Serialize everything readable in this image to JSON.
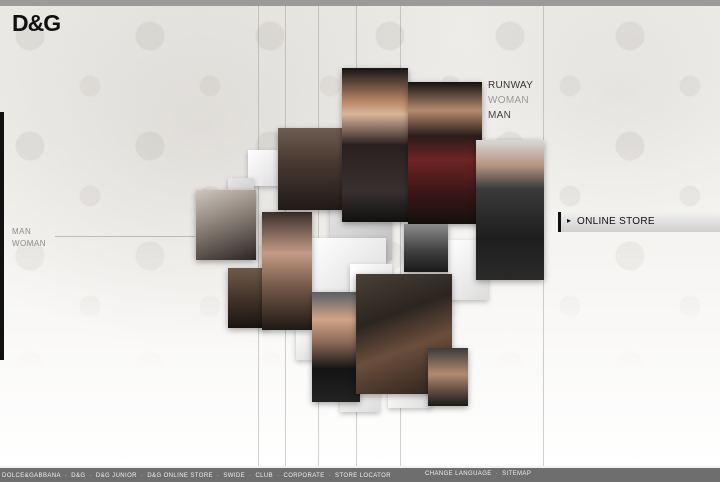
{
  "brand": {
    "logo_text": "D&G"
  },
  "side_nav": {
    "items": [
      "MAN",
      "WOMAN"
    ]
  },
  "collections_menu": {
    "items": [
      "RUNWAY",
      "WOMAN",
      "MAN"
    ]
  },
  "online_store": {
    "arrow": "▸",
    "label": "ONLINE STORE"
  },
  "footer": {
    "left_links": [
      "DOLCE&GABBANA",
      "D&G",
      "D&G JUNIOR",
      "D&G ONLINE STORE",
      "SWIDE",
      "CLUB",
      "CORPORATE",
      "STORE LOCATOR"
    ],
    "right_links": [
      "CHANGE LANGUAGE",
      "SITEMAP"
    ],
    "separator": "·"
  },
  "colors": {
    "accent": "#111111",
    "footer_bg": "#6e6e6e",
    "background": "#f4f3f1"
  }
}
